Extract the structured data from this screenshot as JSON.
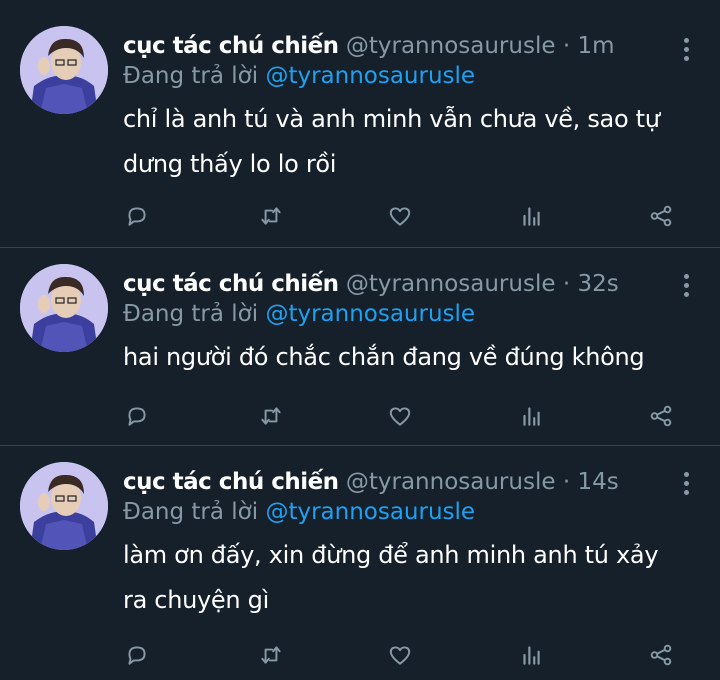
{
  "tweets": [
    {
      "name": "cục tác chú chiến",
      "handle": "@tyrannosaurusle",
      "sep": "·",
      "time": "1m",
      "reply_prefix": "Đang trả lời",
      "reply_to": "@tyrannosaurusle",
      "text": "chỉ là anh tú và anh minh vẫn chưa về, sao tự dưng thấy lo lo rồi"
    },
    {
      "name": "cục tác chú chiến",
      "handle": "@tyrannosaurusle",
      "sep": "·",
      "time": "32s",
      "reply_prefix": "Đang trả lời",
      "reply_to": "@tyrannosaurusle",
      "text": "hai người đó chắc chắn đang về đúng không"
    },
    {
      "name": "cục tác chú chiến",
      "handle": "@tyrannosaurusle",
      "sep": "·",
      "time": "14s",
      "reply_prefix": "Đang trả lời",
      "reply_to": "@tyrannosaurusle",
      "text": "làm ơn đấy, xin đừng để anh minh anh tú xảy ra chuyện gì"
    }
  ],
  "icons": {
    "reply": "reply-icon",
    "retweet": "retweet-icon",
    "like": "heart-icon",
    "analytics": "analytics-icon",
    "share": "share-icon",
    "more": "more-vertical-icon"
  },
  "colors": {
    "background": "#15202b",
    "divider": "#38444d",
    "secondary_text": "#8899a6",
    "mention": "#1da1f2"
  }
}
